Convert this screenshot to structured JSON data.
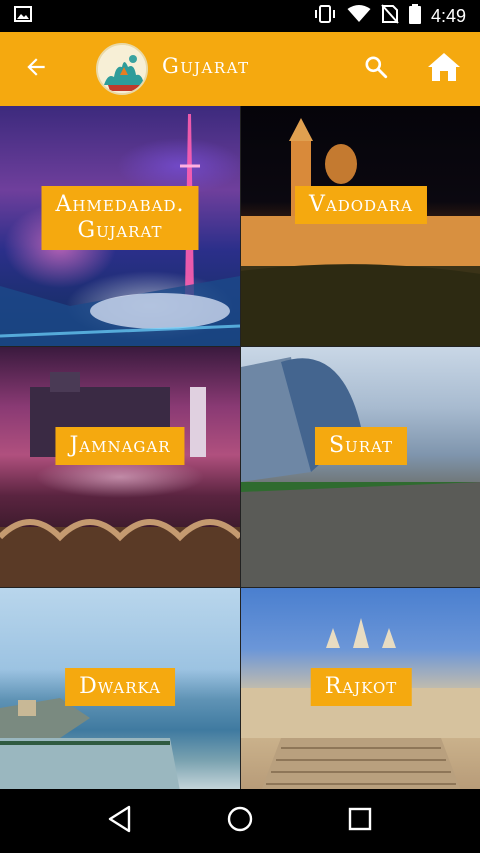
{
  "status_bar": {
    "time": "4:49",
    "icons": [
      "image-icon",
      "vibrate-icon",
      "wifi-icon",
      "no-sim-icon",
      "battery-icon"
    ]
  },
  "app_bar": {
    "title": "Gujarat",
    "icons": [
      "back-arrow-icon",
      "app-logo",
      "search-icon",
      "home-icon"
    ],
    "background_color": "#f5a90f"
  },
  "cities": [
    {
      "label": "Ahmedabad.\nGujarat"
    },
    {
      "label": "Vadodara"
    },
    {
      "label": "Jamnagar"
    },
    {
      "label": "Surat"
    },
    {
      "label": "Dwarka"
    },
    {
      "label": "Rajkot"
    }
  ],
  "nav_bar": {
    "icons": [
      "nav-back-icon",
      "nav-home-icon",
      "nav-recents-icon"
    ]
  }
}
